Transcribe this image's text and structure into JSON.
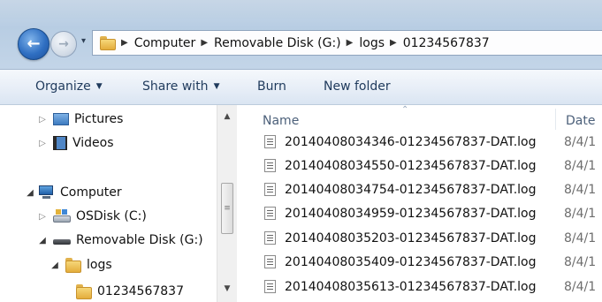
{
  "window": {
    "breadcrumb": [
      "Computer",
      "Removable Disk (G:)",
      "logs",
      "01234567837"
    ]
  },
  "toolbar": {
    "organize_label": "Organize",
    "share_with_label": "Share with",
    "burn_label": "Burn",
    "new_folder_label": "New folder"
  },
  "navpane": {
    "items": [
      {
        "label": "Pictures",
        "icon": "pictures-library-icon",
        "expanded": false
      },
      {
        "label": "Videos",
        "icon": "videos-library-icon",
        "expanded": false
      },
      {
        "label": "Computer",
        "icon": "computer-icon",
        "expanded": true
      },
      {
        "label": "OSDisk (C:)",
        "icon": "local-disk-icon",
        "expanded": false
      },
      {
        "label": "Removable Disk (G:)",
        "icon": "removable-disk-icon",
        "expanded": true
      },
      {
        "label": "logs",
        "icon": "folder-icon",
        "expanded": true
      },
      {
        "label": "01234567837",
        "icon": "folder-icon",
        "selected": true
      }
    ]
  },
  "filelist": {
    "columns": {
      "name": "Name",
      "date": "Date"
    },
    "rows": [
      {
        "name": "20140408034346-01234567837-DAT.log",
        "date": "8/4/1"
      },
      {
        "name": "20140408034550-01234567837-DAT.log",
        "date": "8/4/1"
      },
      {
        "name": "20140408034754-01234567837-DAT.log",
        "date": "8/4/1"
      },
      {
        "name": "20140408034959-01234567837-DAT.log",
        "date": "8/4/1"
      },
      {
        "name": "20140408035203-01234567837-DAT.log",
        "date": "8/4/1"
      },
      {
        "name": "20140408035409-01234567837-DAT.log",
        "date": "8/4/1"
      },
      {
        "name": "20140408035613-01234567837-DAT.log",
        "date": "8/4/1"
      }
    ]
  }
}
